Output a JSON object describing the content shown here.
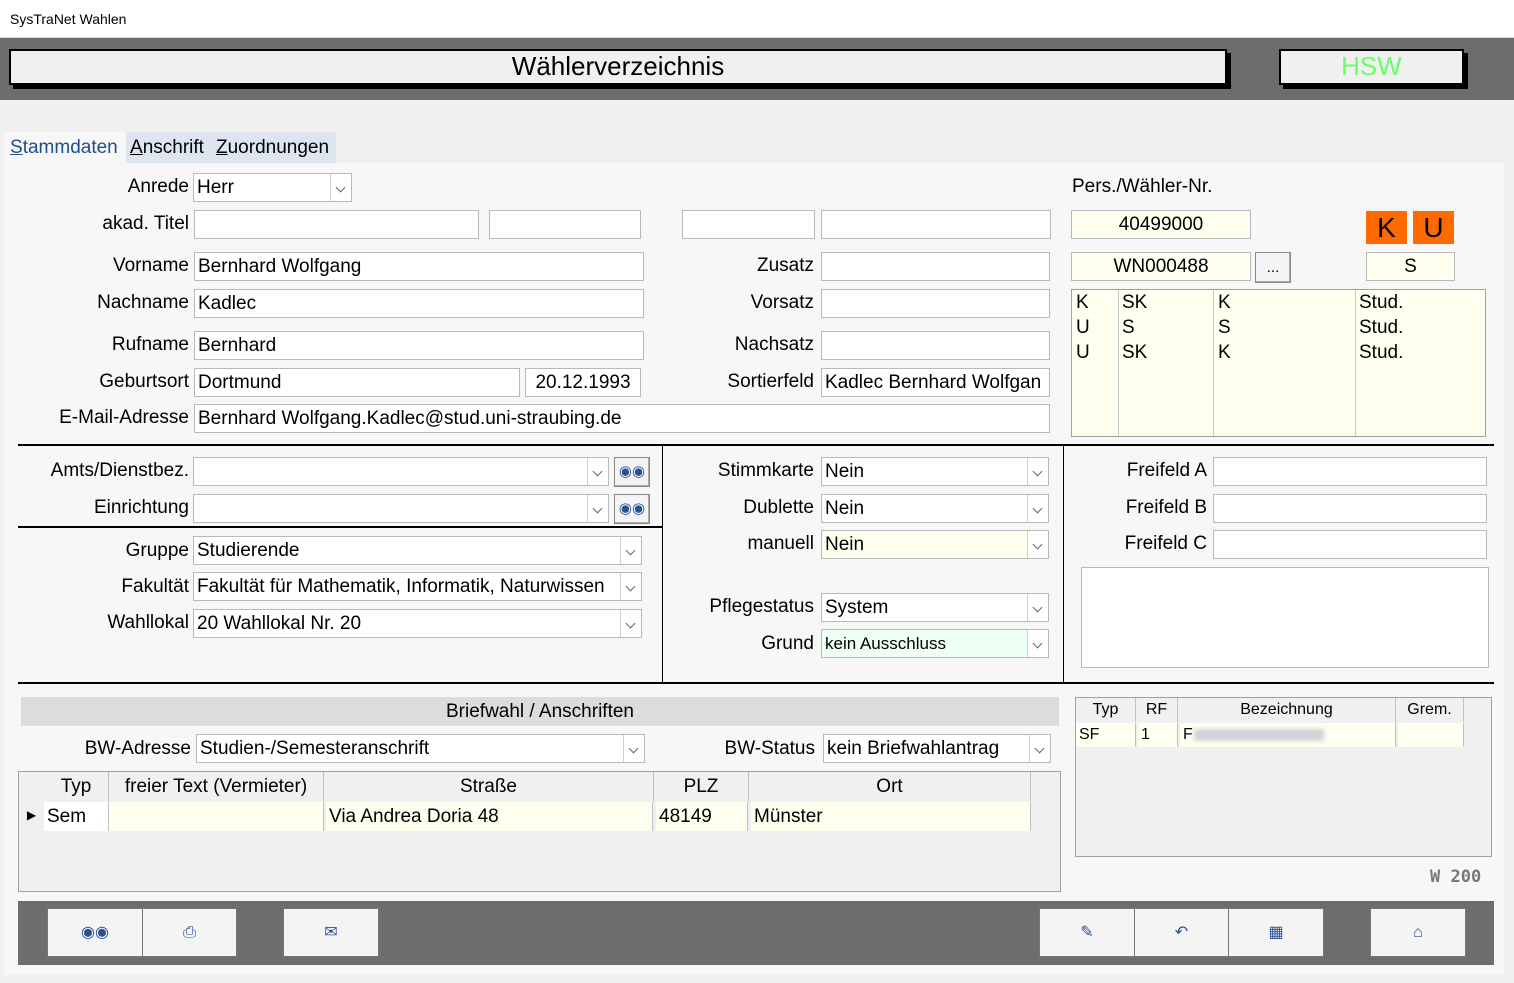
{
  "window": {
    "title": "SysTraNet Wahlen"
  },
  "banner": {
    "title": "Wählerverzeichnis",
    "badge": "HSW",
    "badge_color": "#66ff66"
  },
  "tabs": [
    {
      "label": "Stammdaten",
      "hotkey": "S",
      "rest": "tammdaten"
    },
    {
      "label": "Anschrift",
      "hotkey": "A",
      "rest": "nschrift"
    },
    {
      "label": "Zuordnungen",
      "hotkey": "Z",
      "rest": "uordnungen"
    }
  ],
  "person": {
    "anrede_label": "Anrede",
    "anrede": "Herr",
    "titel_label": "akad. Titel",
    "vorname_label": "Vorname",
    "vorname": "Bernhard Wolfgang",
    "nachname_label": "Nachname",
    "nachname": "Kadlec",
    "rufname_label": "Rufname",
    "rufname": "Bernhard",
    "geburtsort_label": "Geburtsort",
    "geburtsort": "Dortmund",
    "geburtsdatum": "20.12.1993",
    "email_label": "E-Mail-Adresse",
    "email": "Bernhard Wolfgang.Kadlec@stud.uni-straubing.de",
    "zusatz_label": "Zusatz",
    "vorsatz_label": "Vorsatz",
    "nachsatz_label": "Nachsatz",
    "sortierfeld_label": "Sortierfeld",
    "sortierfeld": "Kadlec Bernhard Wolfgan"
  },
  "ids": {
    "pers_label": "Pers./Wähler-Nr.",
    "pers_nr": "40499000",
    "waehler_nr": "WN000488",
    "more_label": "...",
    "badge_k": "K",
    "badge_u": "U",
    "status_s": "S",
    "rows": [
      [
        "K",
        "SK",
        "K",
        "Stud."
      ],
      [
        "U",
        "S",
        "S",
        "Stud."
      ],
      [
        "U",
        "SK",
        "K",
        "Stud."
      ]
    ]
  },
  "org": {
    "amts_label": "Amts/Dienstbez.",
    "einrichtung_label": "Einrichtung",
    "gruppe_label": "Gruppe",
    "gruppe": "Studierende",
    "fakultaet_label": "Fakultät",
    "fakultaet": "Fakultät für Mathematik, Informatik, Naturwissen",
    "wahllokal_label": "Wahllokal",
    "wahllokal": "20 Wahllokal Nr. 20"
  },
  "status": {
    "stimmkarte_label": "Stimmkarte",
    "stimmkarte": "Nein",
    "dublette_label": "Dublette",
    "dublette": "Nein",
    "manuell_label": "manuell",
    "manuell": "Nein",
    "pflegestatus_label": "Pflegestatus",
    "pflegestatus": "System",
    "grund_label": "Grund",
    "grund": "kein Ausschluss"
  },
  "freifelder": {
    "a_label": "Freifeld A",
    "b_label": "Freifeld B",
    "c_label": "Freifeld C"
  },
  "briefwahl": {
    "header": "Briefwahl / Anschriften",
    "bw_adresse_label": "BW-Adresse",
    "bw_adresse": "Studien-/Semesteranschrift",
    "bw_status_label": "BW-Status",
    "bw_status": "kein Briefwahlantrag",
    "columns": [
      "Typ",
      "freier Text (Vermieter)",
      "Straße",
      "PLZ",
      "Ort"
    ],
    "rows": [
      {
        "typ": "Sem",
        "text": "",
        "strasse": "Via Andrea Doria 48",
        "plz": "48149",
        "ort": "Münster"
      }
    ]
  },
  "gremien": {
    "columns": [
      "Typ",
      "RF",
      "Bezeichnung",
      "Grem."
    ],
    "rows": [
      {
        "typ": "SF",
        "rf": "1",
        "bez": "F",
        "grem": ""
      }
    ]
  },
  "footer": {
    "code": "W 200"
  }
}
